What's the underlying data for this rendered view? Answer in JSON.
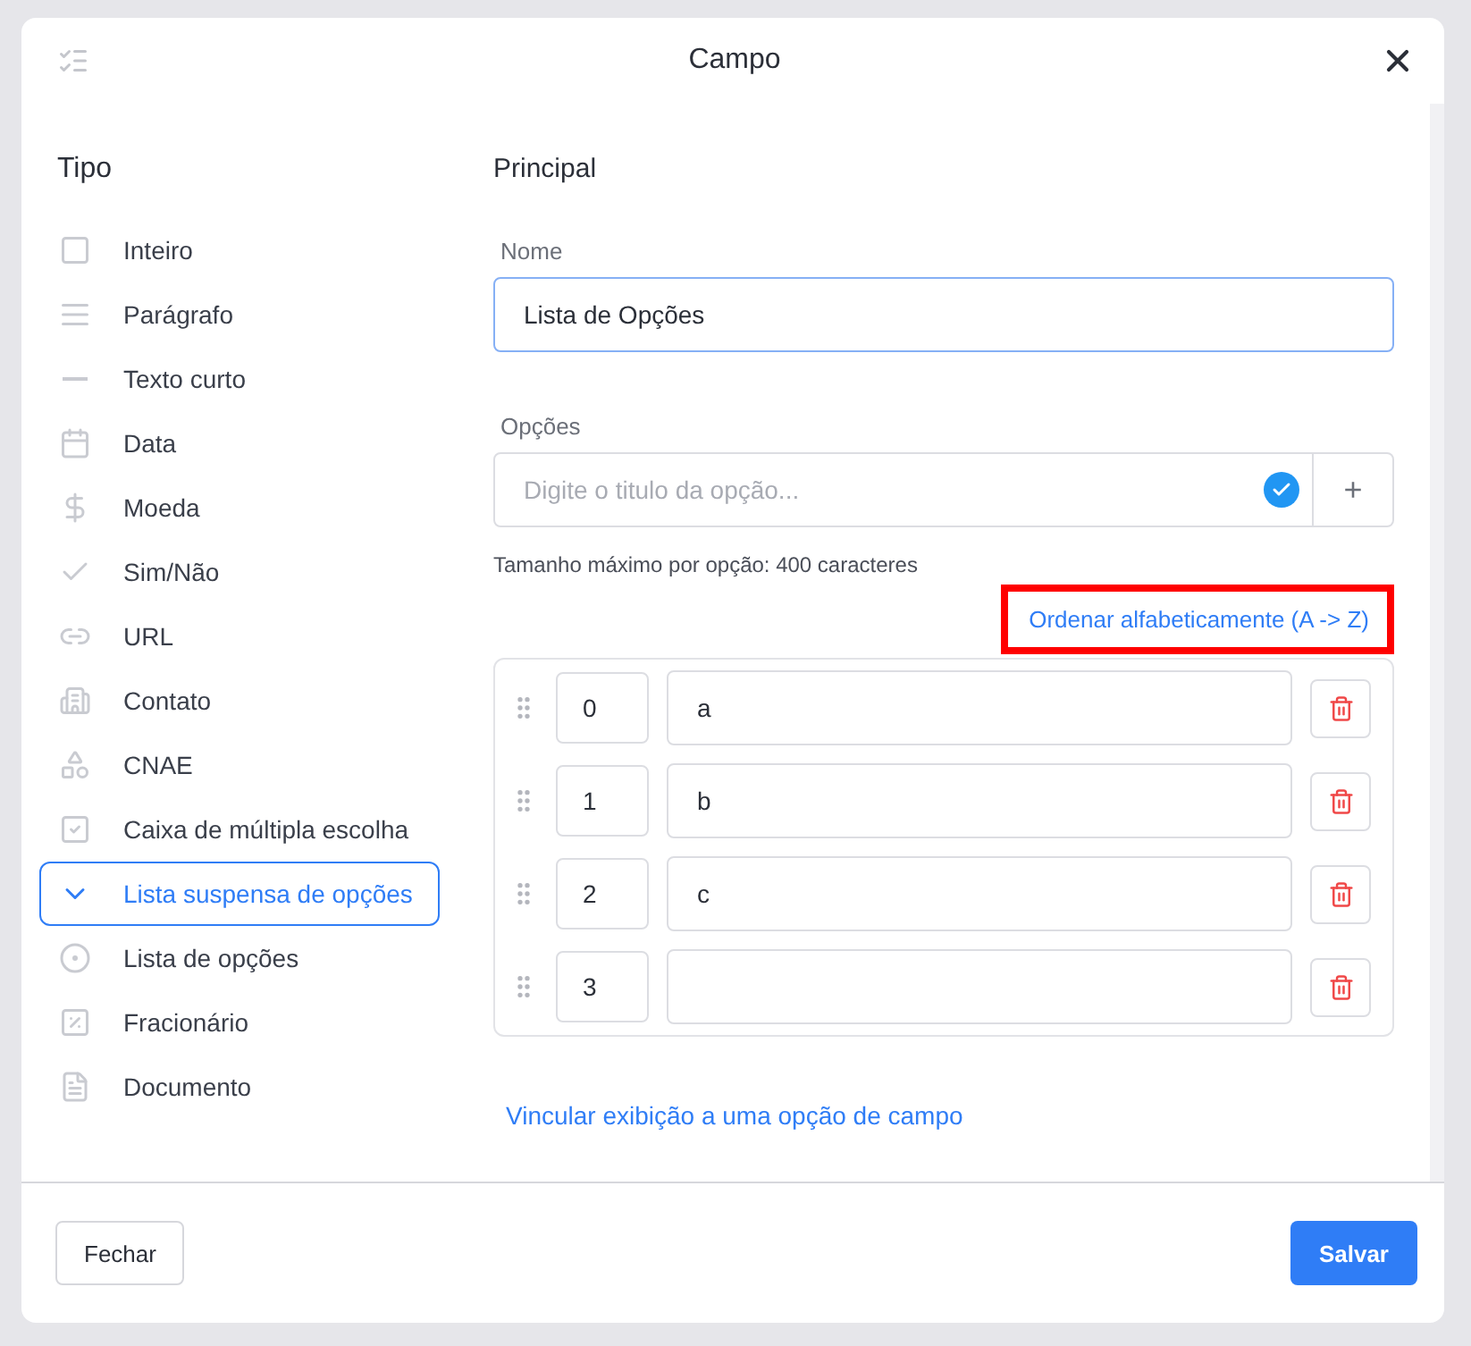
{
  "dialog": {
    "title": "Campo"
  },
  "sidebar": {
    "title": "Tipo",
    "items": [
      {
        "kind": "integer",
        "label": "Inteiro",
        "selected": false
      },
      {
        "kind": "paragraph",
        "label": "Parágrafo",
        "selected": false
      },
      {
        "kind": "short",
        "label": "Texto curto",
        "selected": false
      },
      {
        "kind": "date",
        "label": "Data",
        "selected": false
      },
      {
        "kind": "currency",
        "label": "Moeda",
        "selected": false
      },
      {
        "kind": "boolean",
        "label": "Sim/Não",
        "selected": false
      },
      {
        "kind": "url",
        "label": "URL",
        "selected": false
      },
      {
        "kind": "contact",
        "label": "Contato",
        "selected": false
      },
      {
        "kind": "cnae",
        "label": "CNAE",
        "selected": false
      },
      {
        "kind": "multi",
        "label": "Caixa de múltipla escolha",
        "selected": false
      },
      {
        "kind": "dropdown",
        "label": "Lista suspensa de opções",
        "selected": true
      },
      {
        "kind": "radio",
        "label": "Lista de opções",
        "selected": false
      },
      {
        "kind": "fraction",
        "label": "Fracionário",
        "selected": false
      },
      {
        "kind": "document",
        "label": "Documento",
        "selected": false
      }
    ]
  },
  "main": {
    "title": "Principal",
    "name_field": {
      "label": "Nome",
      "value": "Lista de Opções"
    },
    "options_field": {
      "label": "Opções",
      "placeholder": "Digite o titulo da opção...",
      "add_button": "+",
      "hint": "Tamanho máximo por opção: 400 caracteres"
    },
    "sort_link": {
      "label": "Ordenar alfabeticamente (A -> Z)",
      "highlighted": true
    },
    "options": [
      {
        "index": "0",
        "value": "a"
      },
      {
        "index": "1",
        "value": "b"
      },
      {
        "index": "2",
        "value": "c"
      },
      {
        "index": "3"
      }
    ],
    "link": "Vincular exibição a uma opção de campo"
  },
  "footer": {
    "close": "Fechar",
    "save": "Salvar"
  }
}
